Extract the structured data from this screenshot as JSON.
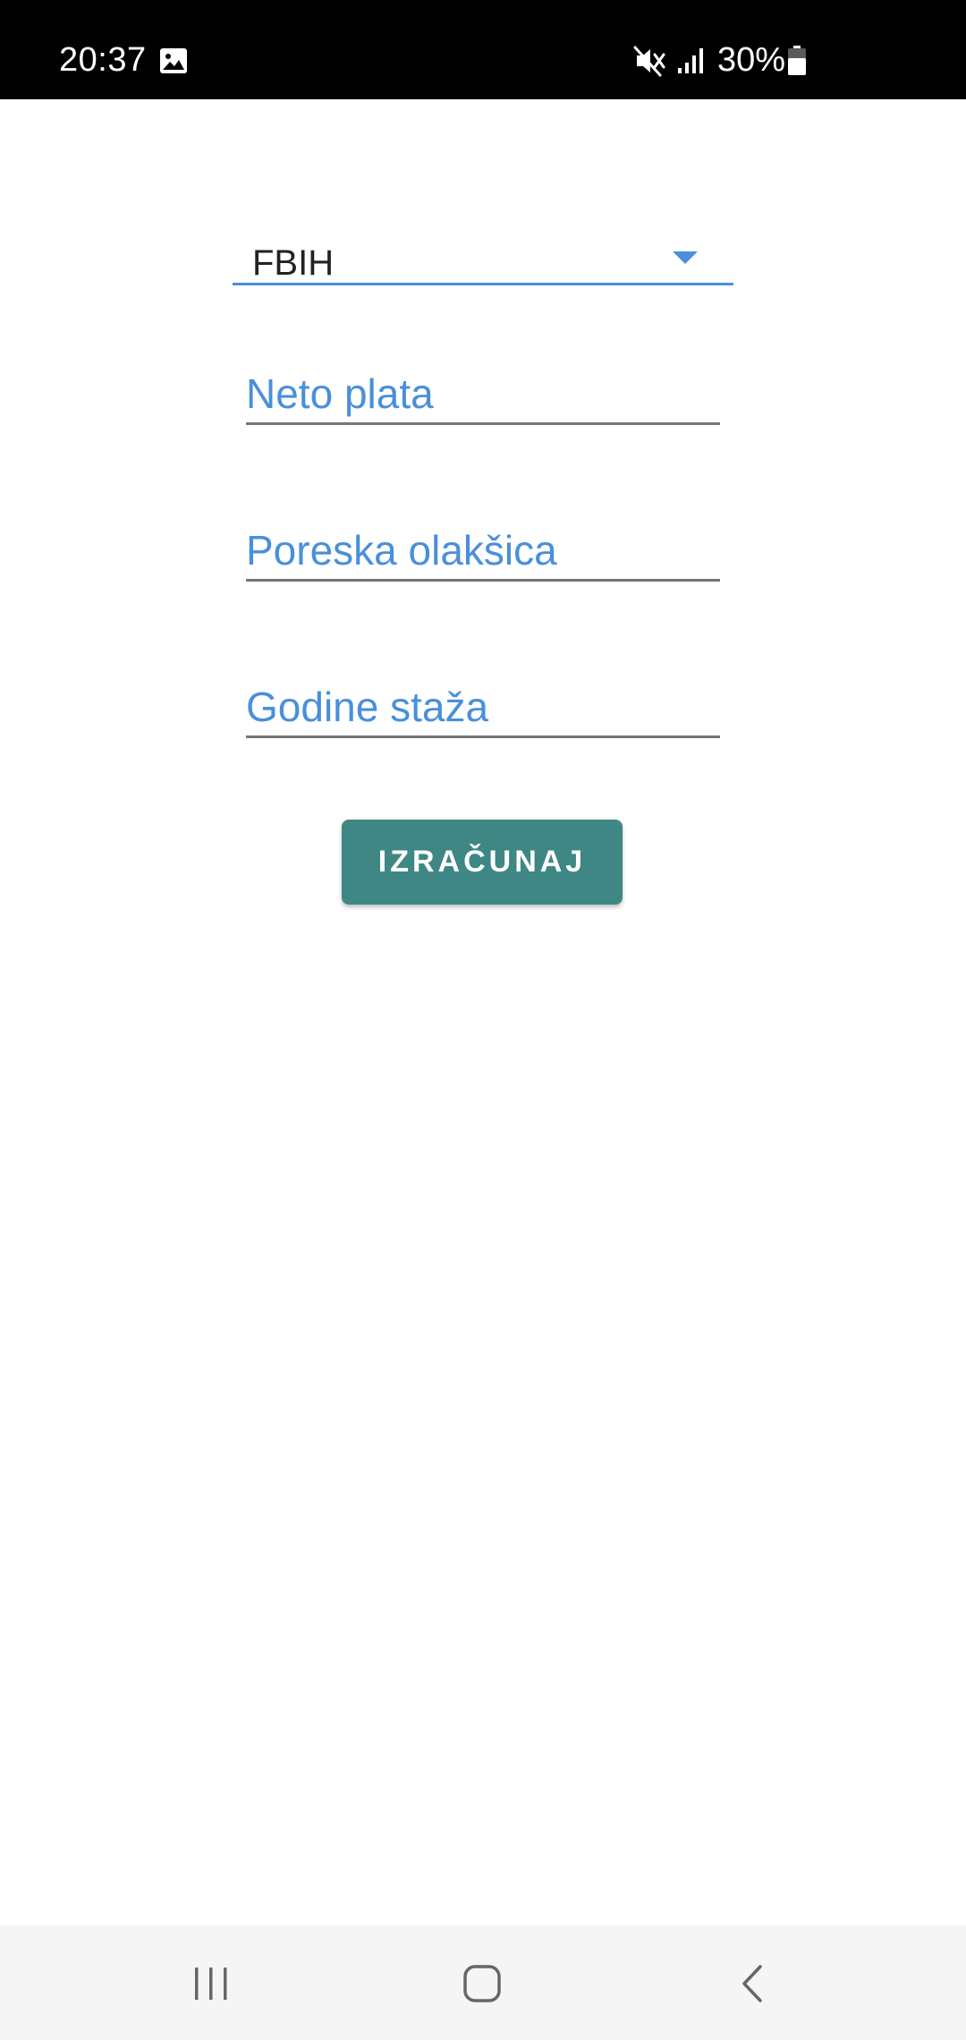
{
  "status_bar": {
    "time": "20:37",
    "battery": "30%",
    "icons": [
      "gallery-icon",
      "mute-icon",
      "signal-icon",
      "battery-icon"
    ]
  },
  "form": {
    "region_select": {
      "value": "FBIH"
    },
    "net_salary": {
      "placeholder": "Neto plata"
    },
    "tax_relief": {
      "placeholder": "Poreska olakšica"
    },
    "years_of_service": {
      "placeholder": "Godine staža"
    },
    "calculate_button": "IZRAČUNAJ"
  },
  "colors": {
    "accent": "#4a90d9",
    "button": "#3f8784",
    "status_bar": "#000000",
    "nav_bar": "#f5f5f5"
  },
  "nav_bar": {
    "icons": [
      "recent-apps-icon",
      "home-icon",
      "back-icon"
    ]
  }
}
